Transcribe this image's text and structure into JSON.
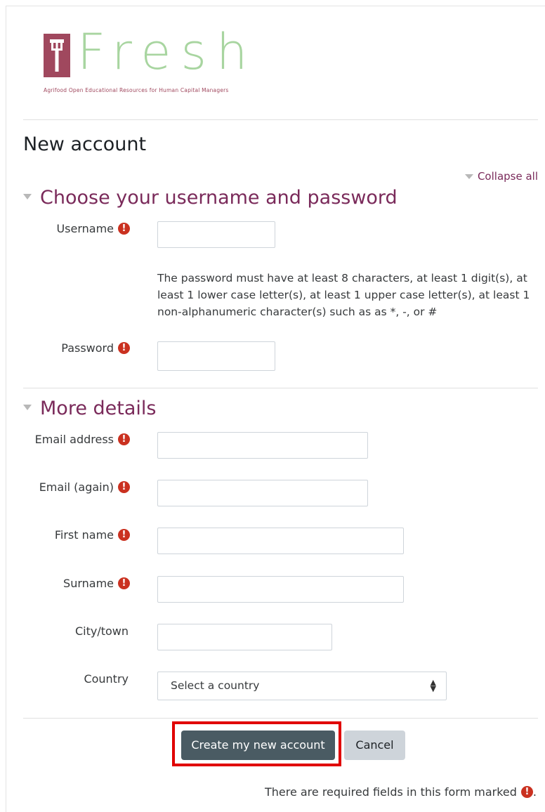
{
  "brand": {
    "logo_text": "Fresh",
    "tagline": "Agrifood Open Educational Resources for Human Capital Managers",
    "colors": {
      "logo_box": "#a0485e",
      "logo_text": "#a8d5a0",
      "accent": "#7a2a5a",
      "required": "#ca3120"
    }
  },
  "page": {
    "title": "New account",
    "collapse_all": "Collapse all"
  },
  "sections": [
    {
      "title": "Choose your username and password"
    },
    {
      "title": "More details"
    }
  ],
  "fields": {
    "username": {
      "label": "Username",
      "required": true,
      "value": ""
    },
    "password_note": "The password must have at least 8 characters, at least 1 digit(s), at least 1 lower case letter(s), at least 1 upper case letter(s), at least 1 non-alphanumeric character(s) such as as *, -, or #",
    "password": {
      "label": "Password",
      "required": true,
      "value": ""
    },
    "email": {
      "label": "Email address",
      "required": true,
      "value": ""
    },
    "email2": {
      "label": "Email (again)",
      "required": true,
      "value": ""
    },
    "firstname": {
      "label": "First name",
      "required": true,
      "value": ""
    },
    "surname": {
      "label": "Surname",
      "required": true,
      "value": ""
    },
    "city": {
      "label": "City/town",
      "required": false,
      "value": ""
    },
    "country": {
      "label": "Country",
      "selected": "Select a country"
    }
  },
  "buttons": {
    "submit": "Create my new account",
    "cancel": "Cancel"
  },
  "footer": {
    "required_note": "There are required fields in this form marked",
    "required_icon": "!",
    "period": "."
  }
}
